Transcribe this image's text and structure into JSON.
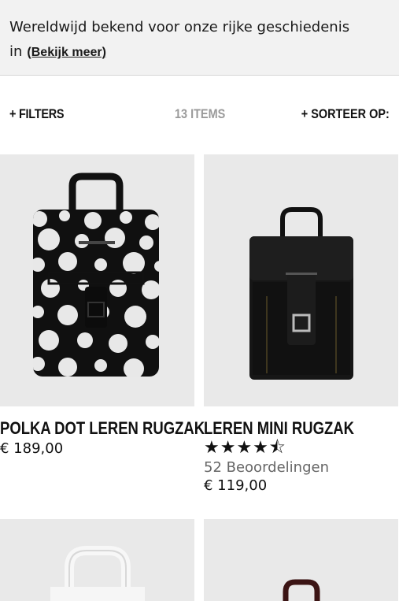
{
  "banner": {
    "text": "Wereldwijd bekend voor onze rijke geschiedenis in",
    "link": "(Bekijk meer)"
  },
  "toolbar": {
    "filters": "+ FILTERS",
    "count": "13 ITEMS",
    "sort": "+  SORTEER OP:"
  },
  "products": [
    {
      "name": "POLKA DOT LEREN RUGZAK",
      "price": "€ 189,00"
    },
    {
      "name": "LEREN MINI RUGZAK",
      "rating": 4.5,
      "stars": "★★★★⯪",
      "reviews": "52 Beoordelingen",
      "price": "€ 119,00"
    }
  ],
  "colors": {
    "background": "#ffffff",
    "banner": "#f2f2f2",
    "image_bg": "#e9e9e9",
    "muted": "#9a9a9a"
  }
}
